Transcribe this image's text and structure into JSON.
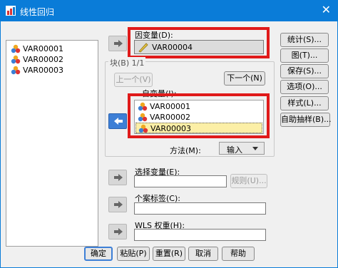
{
  "window": {
    "title": "线性回归",
    "close_glyph": "✕"
  },
  "source_vars": [
    "VAR00001",
    "VAR00002",
    "VAR00003"
  ],
  "dependent": {
    "label": "因变量(D):",
    "value": "VAR00004"
  },
  "block": {
    "label": "块(B) 1/1",
    "prev": "上一个(V)",
    "next": "下一个(N)"
  },
  "independent": {
    "label": "自变量(I):",
    "items": [
      "VAR00001",
      "VAR00002",
      "VAR00003"
    ]
  },
  "method": {
    "label": "方法(M):",
    "value": "输入"
  },
  "selection": {
    "label": "选择变量(E):",
    "rule": "规则(U)..."
  },
  "case_label": {
    "label": "个案标签(C):"
  },
  "wls": {
    "label": "WLS 权重(H):"
  },
  "side_buttons": [
    "统计(S)...",
    "图(T)...",
    "保存(S)...",
    "选项(O)...",
    "样式(L)...",
    "自助抽样(B)..."
  ],
  "bottom_buttons": [
    "确定",
    "粘贴(P)",
    "重置(R)",
    "取消",
    "帮助"
  ],
  "colors": {
    "titlebar": "#0a7cd8",
    "highlight_box": "#e01a1a",
    "selected_row": "#fcefa6"
  }
}
